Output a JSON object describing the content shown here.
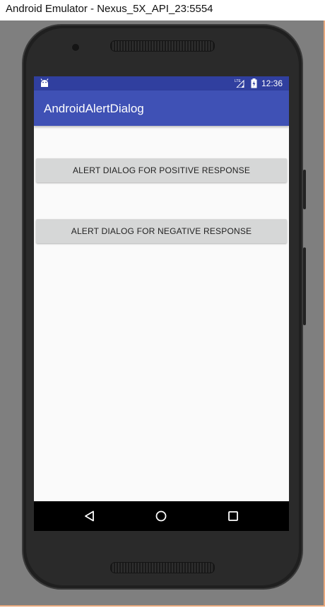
{
  "window": {
    "title": "Android Emulator - Nexus_5X_API_23:5554"
  },
  "statusbar": {
    "time": "12:36",
    "icons": [
      "android-icon",
      "lte-signal-icon",
      "battery-charging-icon"
    ]
  },
  "appbar": {
    "title": "AndroidAlertDialog"
  },
  "main": {
    "positive_button_label": "ALERT DIALOG FOR POSITIVE RESPONSE",
    "negative_button_label": "ALERT DIALOG FOR NEGATIVE RESPONSE"
  },
  "navbar": {
    "icons": [
      "back-icon",
      "home-icon",
      "recents-icon"
    ]
  },
  "colors": {
    "statusbar": "#303f9f",
    "appbar": "#3f51b5",
    "button": "#d6d7d7",
    "screen_background": "#fafafa",
    "emulator_background": "#7f7f7f"
  }
}
